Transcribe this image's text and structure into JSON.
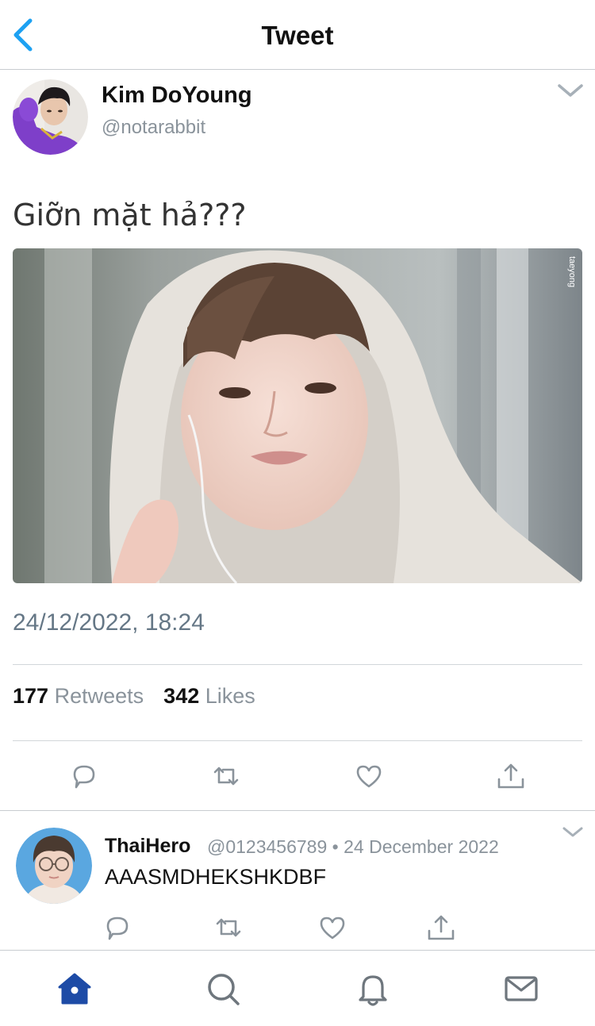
{
  "header": {
    "title": "Tweet",
    "back_icon": "chevron-left-icon",
    "accent_color": "#1da1f2"
  },
  "tweet": {
    "author_name": "Kim DoYoung",
    "author_handle": "@notarabbit",
    "text": "Giỡn mặt hả???",
    "photo_watermark": "taeyong",
    "timestamp": "24/12/2022, 18:24",
    "retweets_count": "177",
    "retweets_label": "Retweets",
    "likes_count": "342",
    "likes_label": "Likes",
    "actions": [
      "reply-icon",
      "retweet-icon",
      "like-icon",
      "share-icon"
    ]
  },
  "reply": {
    "author_name": "ThaiHero",
    "author_handle": "@0123456789",
    "separator": "•",
    "date": "24 December 2022",
    "text": "AAASMDHEKSHKDBF",
    "actions": [
      "reply-icon",
      "retweet-icon",
      "like-icon",
      "share-icon"
    ]
  },
  "tabbar": {
    "items": [
      "home-icon",
      "search-icon",
      "notifications-icon",
      "messages-icon"
    ],
    "active_color": "#1d4ba6"
  }
}
